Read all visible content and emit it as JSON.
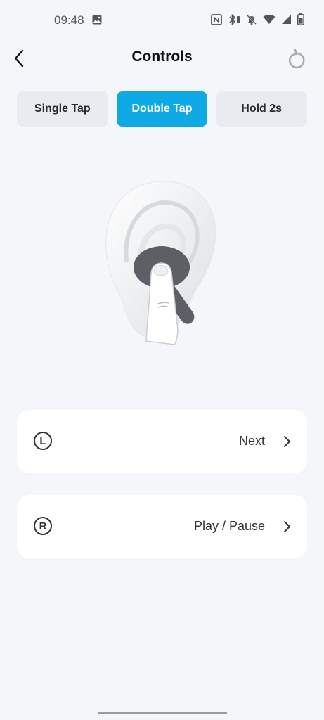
{
  "status_bar": {
    "time": "09:48"
  },
  "header": {
    "title": "Controls"
  },
  "tabs": [
    {
      "label": "Single Tap",
      "active": false
    },
    {
      "label": "Double Tap",
      "active": true
    },
    {
      "label": "Hold 2s",
      "active": false
    }
  ],
  "controls": {
    "left": {
      "side": "L",
      "action": "Next"
    },
    "right": {
      "side": "R",
      "action": "Play / Pause"
    }
  },
  "colors": {
    "accent": "#0fa9e6",
    "background": "#f4f6f9"
  },
  "icons": {
    "back": "chevron-left-icon",
    "reset": "reset-icon",
    "chevron": "chevron-right-icon"
  }
}
